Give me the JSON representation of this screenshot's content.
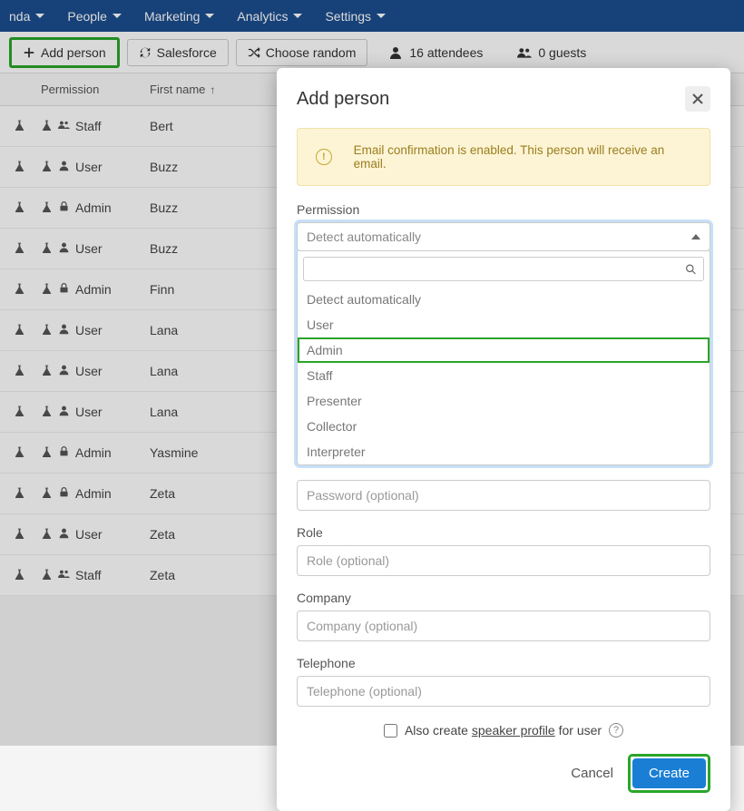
{
  "nav": {
    "items": [
      "nda",
      "People",
      "Marketing",
      "Analytics",
      "Settings"
    ]
  },
  "toolbar": {
    "add_person": "Add person",
    "salesforce": "Salesforce",
    "choose_random": "Choose random",
    "attendees_count": "16 attendees",
    "guests_count": "0 guests"
  },
  "table": {
    "headers": {
      "permission": "Permission",
      "firstname": "First name"
    },
    "rows": [
      {
        "perm_icon": "people",
        "permission": "Staff",
        "firstname": "Bert"
      },
      {
        "perm_icon": "person",
        "permission": "User",
        "firstname": "Buzz"
      },
      {
        "perm_icon": "lock",
        "permission": "Admin",
        "firstname": "Buzz"
      },
      {
        "perm_icon": "person",
        "permission": "User",
        "firstname": "Buzz"
      },
      {
        "perm_icon": "lock",
        "permission": "Admin",
        "firstname": "Finn"
      },
      {
        "perm_icon": "person",
        "permission": "User",
        "firstname": "Lana"
      },
      {
        "perm_icon": "person",
        "permission": "User",
        "firstname": "Lana"
      },
      {
        "perm_icon": "person",
        "permission": "User",
        "firstname": "Lana"
      },
      {
        "perm_icon": "lock",
        "permission": "Admin",
        "firstname": "Yasmine"
      },
      {
        "perm_icon": "lock",
        "permission": "Admin",
        "firstname": "Zeta"
      },
      {
        "perm_icon": "person",
        "permission": "User",
        "firstname": "Zeta"
      },
      {
        "perm_icon": "people",
        "permission": "Staff",
        "firstname": "Zeta"
      }
    ]
  },
  "modal": {
    "title": "Add person",
    "alert": "Email confirmation is enabled. This person will receive an email.",
    "labels": {
      "permission": "Permission",
      "role": "Role",
      "company": "Company",
      "telephone": "Telephone"
    },
    "placeholders": {
      "password": "Password (optional)",
      "role": "Role (optional)",
      "company": "Company (optional)",
      "telephone": "Telephone (optional)"
    },
    "select": {
      "current": "Detect automatically",
      "options": [
        "Detect automatically",
        "User",
        "Admin",
        "Staff",
        "Presenter",
        "Collector",
        "Interpreter"
      ],
      "selected_index": 2
    },
    "speaker_checkbox_pre": "Also create",
    "speaker_checkbox_link": "speaker profile",
    "speaker_checkbox_post": "for user",
    "buttons": {
      "cancel": "Cancel",
      "create": "Create"
    }
  }
}
